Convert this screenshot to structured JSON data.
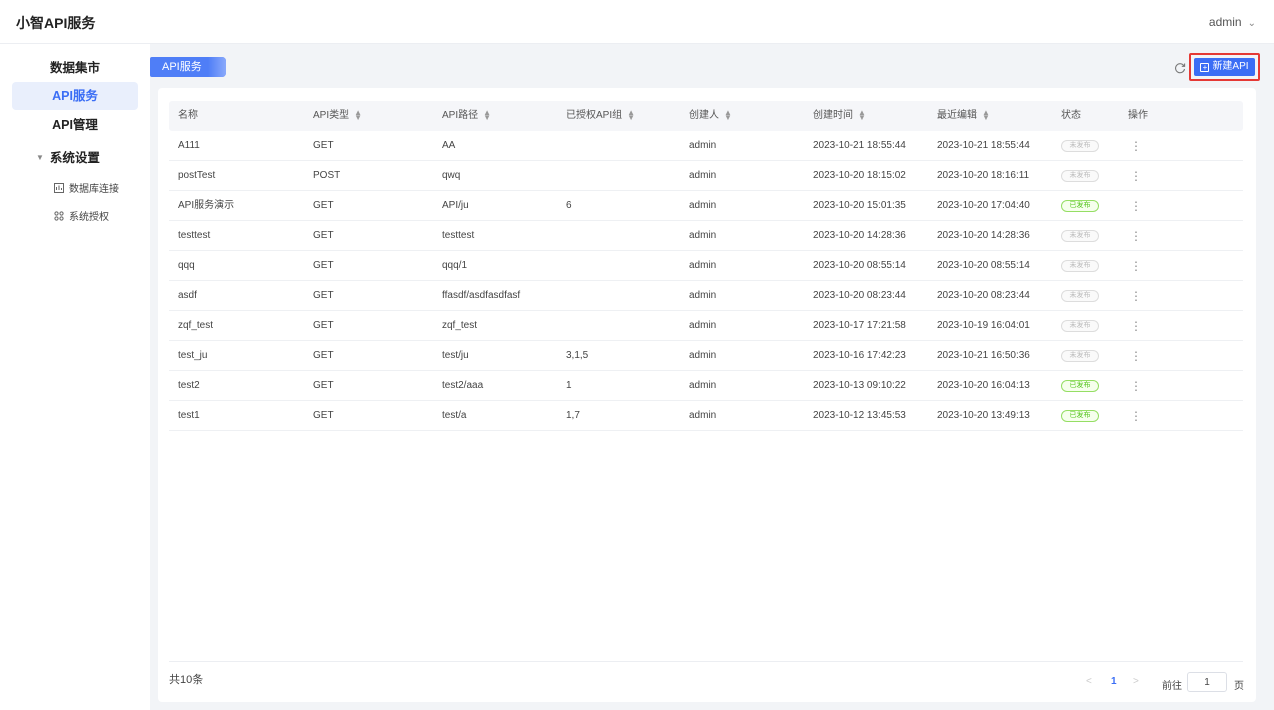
{
  "header": {
    "brand": "小智API服务",
    "user": "admin"
  },
  "sidebar": {
    "items": [
      {
        "label": "数据集市"
      },
      {
        "label": "API服务"
      },
      {
        "label": "API管理"
      }
    ],
    "group": {
      "label": "系统设置"
    },
    "sub_items": [
      {
        "label": "数据库连接",
        "icon": "database-icon"
      },
      {
        "label": "系统授权",
        "icon": "authorization-icon"
      }
    ]
  },
  "tab": {
    "label": "API服务"
  },
  "toolbar": {
    "new_label": "新建API",
    "refresh_icon": "refresh-icon"
  },
  "table": {
    "columns": [
      "名称",
      "API类型",
      "API路径",
      "已授权API组",
      "创建人",
      "创建时间",
      "最近编辑",
      "状态",
      "操作"
    ],
    "rows": [
      {
        "name": "A111",
        "type": "GET",
        "path": "AA",
        "groups": "",
        "creator": "admin",
        "created": "2023-10-21 18:55:44",
        "edited": "2023-10-21 18:55:44",
        "status": "未发布",
        "published": false
      },
      {
        "name": "postTest",
        "type": "POST",
        "path": "qwq",
        "groups": "",
        "creator": "admin",
        "created": "2023-10-20 18:15:02",
        "edited": "2023-10-20 18:16:11",
        "status": "未发布",
        "published": false
      },
      {
        "name": "API服务演示",
        "type": "GET",
        "path": "API/ju",
        "groups": "6",
        "creator": "admin",
        "created": "2023-10-20 15:01:35",
        "edited": "2023-10-20 17:04:40",
        "status": "已发布",
        "published": true
      },
      {
        "name": "testtest",
        "type": "GET",
        "path": "testtest",
        "groups": "",
        "creator": "admin",
        "created": "2023-10-20 14:28:36",
        "edited": "2023-10-20 14:28:36",
        "status": "未发布",
        "published": false
      },
      {
        "name": "qqq",
        "type": "GET",
        "path": "qqq/1",
        "groups": "",
        "creator": "admin",
        "created": "2023-10-20 08:55:14",
        "edited": "2023-10-20 08:55:14",
        "status": "未发布",
        "published": false
      },
      {
        "name": "asdf",
        "type": "GET",
        "path": "ffasdf/asdfasdfasf",
        "groups": "",
        "creator": "admin",
        "created": "2023-10-20 08:23:44",
        "edited": "2023-10-20 08:23:44",
        "status": "未发布",
        "published": false
      },
      {
        "name": "zqf_test",
        "type": "GET",
        "path": "zqf_test",
        "groups": "",
        "creator": "admin",
        "created": "2023-10-17 17:21:58",
        "edited": "2023-10-19 16:04:01",
        "status": "未发布",
        "published": false
      },
      {
        "name": "test_ju",
        "type": "GET",
        "path": "test/ju",
        "groups": "3,1,5",
        "creator": "admin",
        "created": "2023-10-16 17:42:23",
        "edited": "2023-10-21 16:50:36",
        "status": "未发布",
        "published": false
      },
      {
        "name": "test2",
        "type": "GET",
        "path": "test2/aaa",
        "groups": "1",
        "creator": "admin",
        "created": "2023-10-13 09:10:22",
        "edited": "2023-10-20 16:04:13",
        "status": "已发布",
        "published": true
      },
      {
        "name": "test1",
        "type": "GET",
        "path": "test/a",
        "groups": "1,7",
        "creator": "admin",
        "created": "2023-10-12 13:45:53",
        "edited": "2023-10-20 13:49:13",
        "status": "已发布",
        "published": true
      }
    ]
  },
  "footer": {
    "total": "共10条",
    "page": "1",
    "goto_label": "前往",
    "goto_value": "1",
    "goto_suffix": "页"
  }
}
